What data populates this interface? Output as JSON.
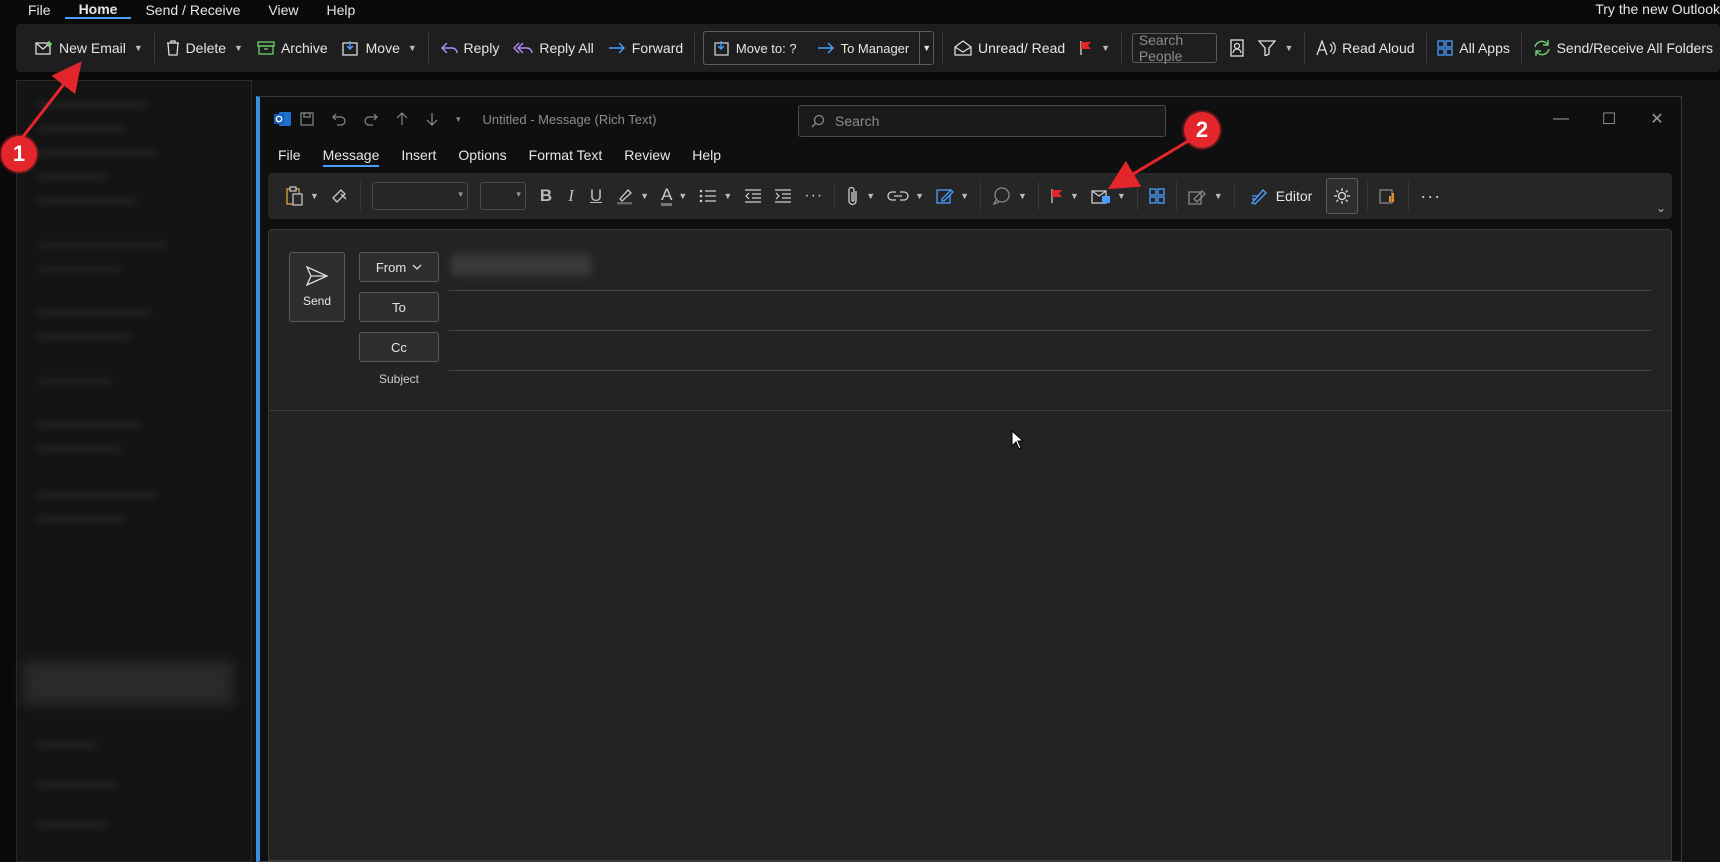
{
  "top_menu": {
    "items": [
      "File",
      "Home",
      "Send / Receive",
      "View",
      "Help"
    ],
    "active": "Home",
    "promo": "Try the new Outlook"
  },
  "main_ribbon": {
    "new_email": "New Email",
    "delete": "Delete",
    "archive": "Archive",
    "move": "Move",
    "reply": "Reply",
    "reply_all": "Reply All",
    "forward": "Forward",
    "quicksteps": [
      "Move to: ?",
      "To Manager"
    ],
    "unread_read": "Unread/ Read",
    "search_people_placeholder": "Search People",
    "read_aloud": "Read Aloud",
    "all_apps": "All Apps",
    "send_receive_all": "Send/Receive All Folders"
  },
  "compose": {
    "title": "Untitled  -  Message (Rich Text)",
    "search_placeholder": "Search",
    "tabs": [
      "File",
      "Message",
      "Insert",
      "Options",
      "Format Text",
      "Review",
      "Help"
    ],
    "active_tab": "Message",
    "ribbon": {
      "bold": "B",
      "italic": "I",
      "underline": "U",
      "font_color": "A",
      "editor": "Editor"
    },
    "send_label": "Send",
    "from_label": "From",
    "to_label": "To",
    "cc_label": "Cc",
    "subject_label": "Subject"
  },
  "annotations": {
    "one": "1",
    "two": "2",
    "color": "#e3262b"
  },
  "colors": {
    "accent": "#4a9eff",
    "compose_border": "#3b8ede",
    "background": "#0a0a0a"
  }
}
